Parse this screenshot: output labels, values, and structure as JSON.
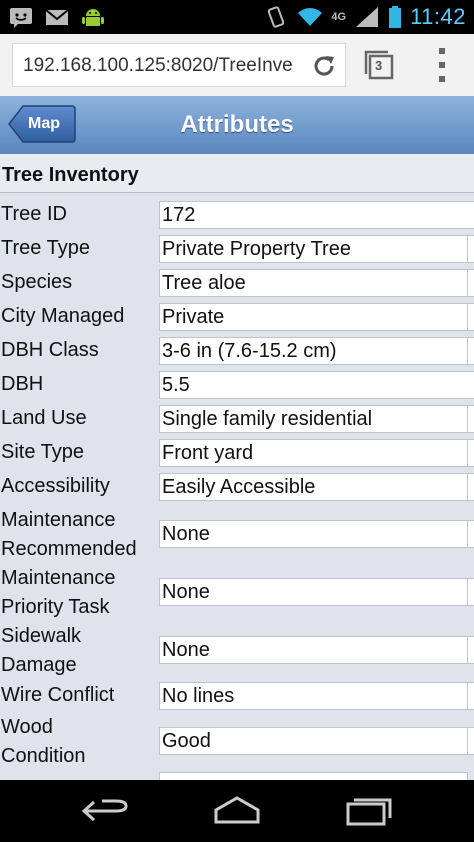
{
  "statusbar": {
    "network": "4G",
    "time": "11:42",
    "icons_left": [
      "message-icon",
      "gmail-icon",
      "android-icon"
    ],
    "icons_right": [
      "vibrate-icon",
      "wifi-icon",
      "signal-icon",
      "battery-icon"
    ]
  },
  "browser": {
    "url": "192.168.100.125:8020/TreeInve",
    "tab_count": "3"
  },
  "header": {
    "back_label": "Map",
    "title": "Attributes",
    "colors": {
      "top": "#8eb4dd",
      "bottom": "#5a86bf"
    }
  },
  "section": {
    "title": "Tree Inventory"
  },
  "fields": [
    {
      "label": "Tree ID",
      "value": "172"
    },
    {
      "label": "Tree Type",
      "value": "Private Property Tree"
    },
    {
      "label": "Species",
      "value": "Tree aloe"
    },
    {
      "label": "City Managed",
      "value": "Private"
    },
    {
      "label": "DBH Class",
      "value": "3-6 in (7.6-15.2 cm)"
    },
    {
      "label": "DBH",
      "value": "5.5"
    },
    {
      "label": "Land Use",
      "value": "Single family residential"
    },
    {
      "label": "Site Type",
      "value": "Front yard"
    },
    {
      "label": "Accessibility",
      "value": "Easily Accessible"
    },
    {
      "label_line1": "Maintenance",
      "label_line2": "Recommended",
      "value": "None"
    },
    {
      "label_line1": "Maintenance",
      "label_line2": "Priority Task",
      "value": "None"
    },
    {
      "label_line1": "Sidewalk",
      "label_line2": "Damage",
      "value": "None"
    },
    {
      "label": "Wire Conflict",
      "value": "No lines"
    },
    {
      "label_line1": "Wood",
      "label_line2": "Condition",
      "value": "Good"
    }
  ],
  "navbar": {
    "icons": [
      "back-icon",
      "home-icon",
      "recent-apps-icon"
    ]
  }
}
